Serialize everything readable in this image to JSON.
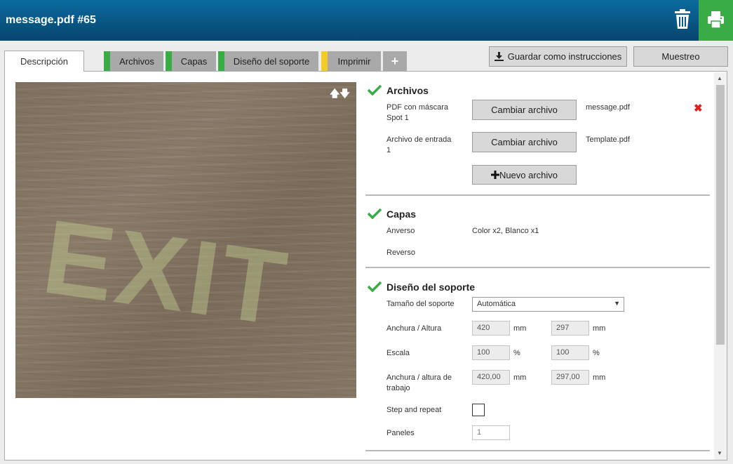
{
  "header": {
    "title": "message.pdf #65",
    "trash_icon": "trash-icon",
    "print_icon": "printer-icon"
  },
  "tabs": [
    {
      "label": "Descripción",
      "stripe": ""
    },
    {
      "label": "Archivos",
      "stripe": "#3aac45"
    },
    {
      "label": "Capas",
      "stripe": "#3aac45"
    },
    {
      "label": "Diseño del soporte",
      "stripe": "#3aac45"
    },
    {
      "label": "Imprimir",
      "stripe": "#f4cc28"
    },
    {
      "label": "+",
      "stripe": ""
    }
  ],
  "actions": {
    "save_as_instructions": "Guardar como instrucciones",
    "sample": "Muestreo"
  },
  "preview": {
    "watermark_text": "EXIT",
    "arrows": "🡅🡇"
  },
  "archivos": {
    "title": "Archivos",
    "rows": [
      {
        "label": "PDF con máscara Spot 1",
        "button": "Cambiar archivo",
        "file": "message.pdf"
      },
      {
        "label": "Archivo de entrada 1",
        "button": "Cambiar archivo",
        "file": "Template.pdf"
      }
    ],
    "new_file": "Nuevo archivo"
  },
  "capas": {
    "title": "Capas",
    "anverso_label": "Anverso",
    "anverso_value": "Color x2, Blanco x1",
    "reverso_label": "Reverso"
  },
  "diseno": {
    "title": "Diseño del soporte",
    "size_label": "Tamaño del soporte",
    "size_value": "Automática",
    "wh_label": "Anchura / Altura",
    "width": "420",
    "height": "297",
    "unit_mm": "mm",
    "scale_label": "Escala",
    "scale_x": "100",
    "scale_y": "100",
    "unit_pct": "%",
    "work_label": "Anchura / altura de trabajo",
    "work_w": "420,00",
    "work_h": "297,00",
    "step_label": "Step and repeat",
    "panels_label": "Paneles",
    "panels_value": "1"
  },
  "colors": {
    "accent_green": "#3aac45",
    "header_blue": "#07466f",
    "delete_red": "#e0211e"
  }
}
